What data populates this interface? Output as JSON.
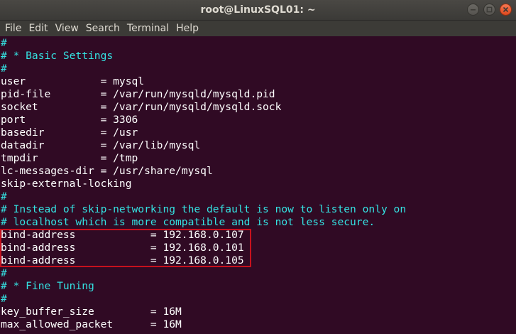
{
  "window": {
    "title": "root@LinuxSQL01: ~"
  },
  "menu": {
    "items": [
      "File",
      "Edit",
      "View",
      "Search",
      "Terminal",
      "Help"
    ]
  },
  "terminal": {
    "lines": [
      {
        "text": "#",
        "type": "comment"
      },
      {
        "text": "# * Basic Settings",
        "type": "comment"
      },
      {
        "text": "#",
        "type": "comment"
      },
      {
        "text": "user            = mysql",
        "type": "plain"
      },
      {
        "text": "pid-file        = /var/run/mysqld/mysqld.pid",
        "type": "plain"
      },
      {
        "text": "socket          = /var/run/mysqld/mysqld.sock",
        "type": "plain"
      },
      {
        "text": "port            = 3306",
        "type": "plain"
      },
      {
        "text": "basedir         = /usr",
        "type": "plain"
      },
      {
        "text": "datadir         = /var/lib/mysql",
        "type": "plain"
      },
      {
        "text": "tmpdir          = /tmp",
        "type": "plain"
      },
      {
        "text": "lc-messages-dir = /usr/share/mysql",
        "type": "plain"
      },
      {
        "text": "skip-external-locking",
        "type": "plain"
      },
      {
        "text": "#",
        "type": "comment"
      },
      {
        "text": "# Instead of skip-networking the default is now to listen only on",
        "type": "comment"
      },
      {
        "text": "# localhost which is more compatible and is not less secure.",
        "type": "comment"
      },
      {
        "text": "bind-address            = 192.168.0.107",
        "type": "plain"
      },
      {
        "text": "bind-address            = 192.168.0.101",
        "type": "plain"
      },
      {
        "text": "bind-address            = 192.168.0.105",
        "type": "plain"
      },
      {
        "text": "#",
        "type": "comment"
      },
      {
        "text": "# * Fine Tuning",
        "type": "comment"
      },
      {
        "text": "#",
        "type": "comment"
      },
      {
        "text": "key_buffer_size         = 16M",
        "type": "plain"
      },
      {
        "text": "max_allowed_packet      = 16M",
        "type": "plain"
      }
    ]
  },
  "colors": {
    "background": "#300a24",
    "comment": "#34e2e2",
    "text": "#ffffff",
    "highlight_border": "#c7111d"
  }
}
